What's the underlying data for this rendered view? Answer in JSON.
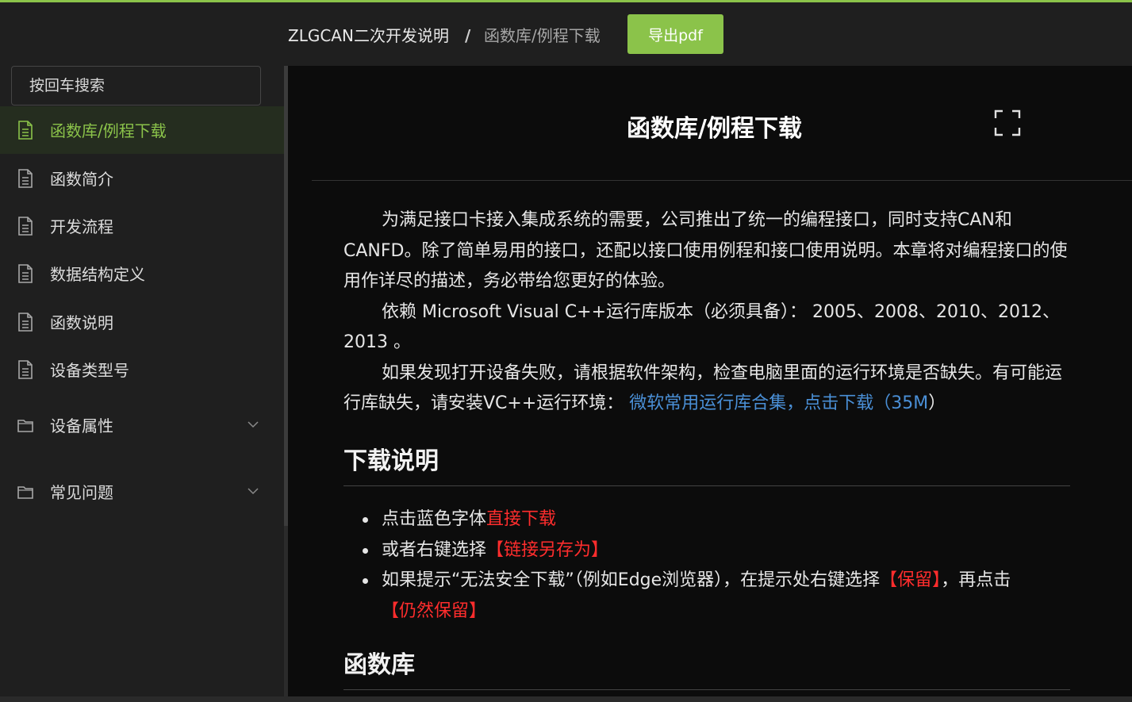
{
  "header": {
    "breadcrumb_root": "ZLGCAN二次开发说明",
    "breadcrumb_sep": "/",
    "breadcrumb_current": "函数库/例程下载",
    "export_label": "导出pdf"
  },
  "sidebar": {
    "search_placeholder": "按回车搜索",
    "items": [
      {
        "label": "函数库/例程下载",
        "icon": "document-icon",
        "active": true
      },
      {
        "label": "函数简介",
        "icon": "document-icon"
      },
      {
        "label": "开发流程",
        "icon": "document-icon"
      },
      {
        "label": "数据结构定义",
        "icon": "document-icon"
      },
      {
        "label": "函数说明",
        "icon": "document-icon"
      },
      {
        "label": "设备类型号",
        "icon": "document-icon"
      },
      {
        "label": "设备属性",
        "icon": "folder-icon",
        "expandable": true
      },
      {
        "label": "常见问题",
        "icon": "folder-icon",
        "expandable": true
      }
    ]
  },
  "content": {
    "title": "函数库/例程下载",
    "p1": "为满足接口卡接入集成系统的需要，公司推出了统一的编程接口，同时支持CAN和CANFD。除了简单易用的接口，还配以接口使用例程和接口使用说明。本章将对编程接口的使用作详尽的描述，务必带给您更好的体验。",
    "p2": "依赖 Microsoft Visual C++运行库版本（必须具备）： 2005、2008、2010、2012、2013 。",
    "p3_text": "如果发现打开设备失败，请根据软件架构，检查电脑里面的运行环境是否缺失。有可能运行库缺失，请安装VC++运行环境： ",
    "p3_link": "微软常用运行库合集，点击下载（35M",
    "p3_tail": "）",
    "h_download": "下载说明",
    "li1_text": "点击蓝色字体",
    "li1_red": "直接下载",
    "li2_text": "或者右键选择",
    "li2_red": "【链接另存为】",
    "li3_text": "如果提示“无法安全下载”（例如Edge浏览器），在提示处右键选择",
    "li3_red1": "【保留】",
    "li3_mid": "，再点击",
    "li3_red2": "【仍然保留】",
    "h_library": "函数库"
  },
  "colors": {
    "accent": "#8bc34a",
    "link": "#4a8fd6",
    "highlight": "#ff2d2d"
  }
}
